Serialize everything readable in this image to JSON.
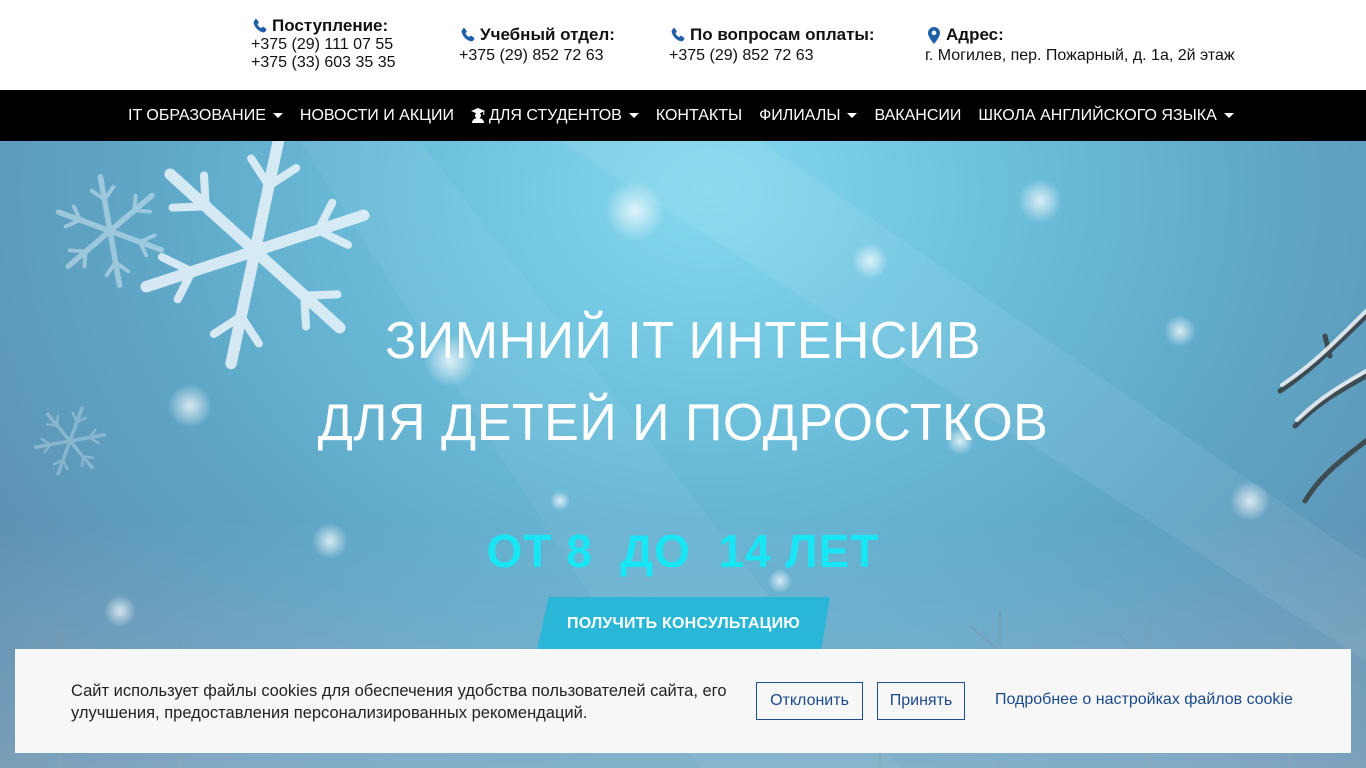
{
  "contacts": [
    {
      "title": "Поступление:",
      "icon": "phone-icon",
      "lines": [
        "+375 (29) 111 07 55",
        "+375 (33) 603 35 35"
      ]
    },
    {
      "title": "Учебный отдел:",
      "icon": "phone-icon",
      "lines": [
        "+375 (29) 852 72 63"
      ]
    },
    {
      "title": "По вопросам оплаты:",
      "icon": "phone-icon",
      "lines": [
        "+375 (29) 852 72 63"
      ]
    },
    {
      "title": "Адрес:",
      "icon": "map-marker-icon",
      "lines": [
        "г. Могилев, пер. Пожарный, д. 1а, 2й этаж"
      ]
    }
  ],
  "nav": {
    "items": [
      {
        "label": "IT образование",
        "dropdown": true
      },
      {
        "label": "Новости и акции",
        "dropdown": false
      },
      {
        "label": "Для студентов",
        "dropdown": true,
        "icon": "graduation-cap-icon"
      },
      {
        "label": "Контакты",
        "dropdown": false
      },
      {
        "label": "Филиалы",
        "dropdown": true
      },
      {
        "label": "Вакансии",
        "dropdown": false
      },
      {
        "label": "Школа английского языка",
        "dropdown": true
      }
    ]
  },
  "hero": {
    "title_line1": "ЗИМНИЙ IT ИНТЕНСИВ",
    "title_line2": "ДЛЯ ДЕТЕЙ И ПОДРОСТКОВ",
    "age": "ОТ 8  ДО  14 ЛЕТ",
    "cta_label": "Получить консультацию"
  },
  "cookie": {
    "text": "Сайт использует файлы cookies для обеспечения удобства пользователей сайта, его улучшения, предоставления персонализированных рекомендаций.",
    "decline_label": "Отклонить",
    "accept_label": "Принять",
    "settings_link": "Подробнее о настройках файлов cookie"
  },
  "colors": {
    "icon_blue": "#1f5fa8",
    "nav_bg": "#000000",
    "age_cyan": "#18e6f4",
    "cta_bg": "#2ab7d7",
    "cookie_link": "#1a4a8c"
  }
}
